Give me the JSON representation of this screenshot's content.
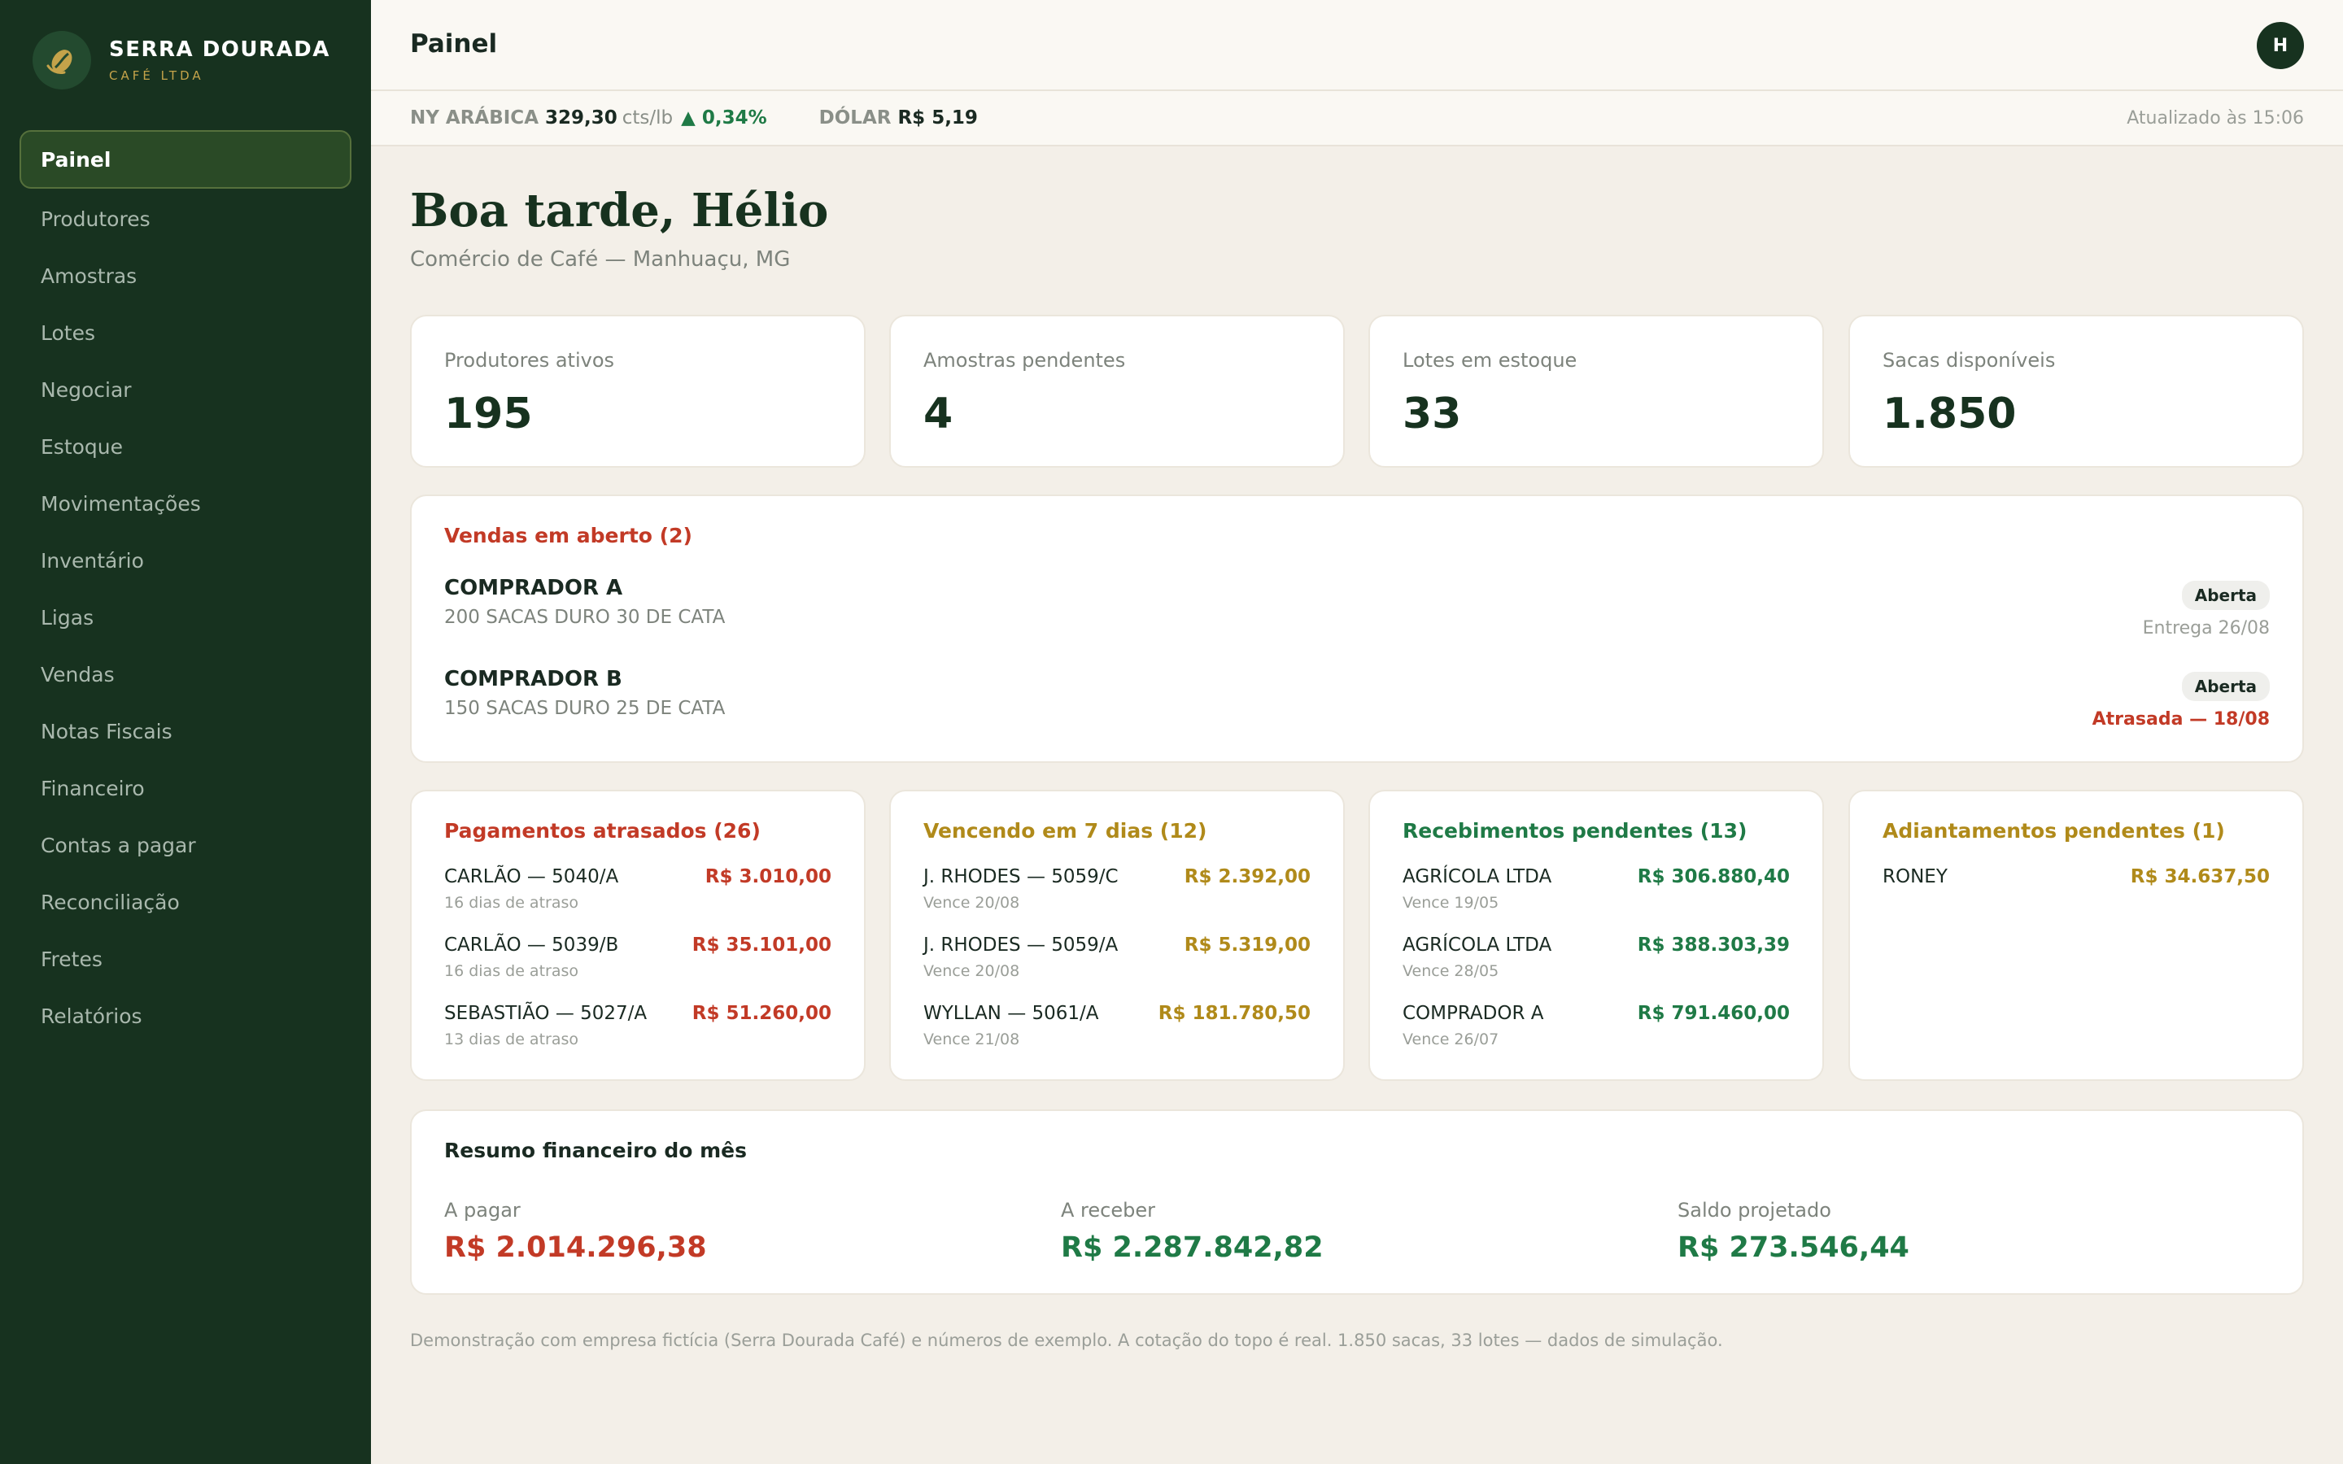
{
  "brand": {
    "name": "SERRA DOURADA",
    "sub": "CAFÉ LTDA"
  },
  "sidebar": {
    "items": [
      {
        "label": "Painel",
        "active": true
      },
      {
        "label": "Produtores"
      },
      {
        "label": "Amostras"
      },
      {
        "label": "Lotes"
      },
      {
        "label": "Negociar"
      },
      {
        "label": "Estoque"
      },
      {
        "label": "Movimentações"
      },
      {
        "label": "Inventário"
      },
      {
        "label": "Ligas"
      },
      {
        "label": "Vendas"
      },
      {
        "label": "Notas Fiscais"
      },
      {
        "label": "Financeiro"
      },
      {
        "label": "Contas a pagar"
      },
      {
        "label": "Reconciliação"
      },
      {
        "label": "Fretes"
      },
      {
        "label": "Relatórios"
      }
    ]
  },
  "header": {
    "title": "Painel",
    "avatar_initial": "H"
  },
  "ticker": {
    "arabica_label": "NY ARÁBICA",
    "arabica_value": "329,30",
    "arabica_unit": "cts/lb",
    "arabica_change": "▲ 0,34%",
    "dollar_label": "DÓLAR",
    "dollar_value": "R$ 5,19",
    "updated": "Atualizado às 15:06"
  },
  "greeting": {
    "title": "Boa tarde, Hélio",
    "subtitle": "Comércio de Café — Manhuaçu, MG"
  },
  "stats": [
    {
      "label": "Produtores ativos",
      "value": "195"
    },
    {
      "label": "Amostras pendentes",
      "value": "4"
    },
    {
      "label": "Lotes em estoque",
      "value": "33"
    },
    {
      "label": "Sacas disponíveis",
      "value": "1.850"
    }
  ],
  "open_sales": {
    "title": "Vendas em aberto (2)",
    "items": [
      {
        "buyer": "COMPRADOR A",
        "desc": "200 SACAS DURO 30 DE CATA",
        "status": "Aberta",
        "date": "Entrega 26/08",
        "late": false
      },
      {
        "buyer": "COMPRADOR B",
        "desc": "150 SACAS DURO 25 DE CATA",
        "status": "Aberta",
        "date": "Atrasada — 18/08",
        "late": true
      }
    ]
  },
  "panels": [
    {
      "title": "Pagamentos atrasados (26)",
      "color": "#c23a26",
      "rows": [
        {
          "name": "CARLÃO — 5040/A",
          "sub": "16 dias de atraso",
          "amount": "R$ 3.010,00"
        },
        {
          "name": "CARLÃO — 5039/B",
          "sub": "16 dias de atraso",
          "amount": "R$ 35.101,00"
        },
        {
          "name": "SEBASTIÃO — 5027/A",
          "sub": "13 dias de atraso",
          "amount": "R$ 51.260,00"
        }
      ]
    },
    {
      "title": "Vencendo em 7 dias (12)",
      "color": "#b08a1a",
      "rows": [
        {
          "name": "J. RHODES — 5059/C",
          "sub": "Vence 20/08",
          "amount": "R$ 2.392,00"
        },
        {
          "name": "J. RHODES — 5059/A",
          "sub": "Vence 20/08",
          "amount": "R$ 5.319,00"
        },
        {
          "name": "WYLLAN — 5061/A",
          "sub": "Vence 21/08",
          "amount": "R$ 181.780,50"
        }
      ]
    },
    {
      "title": "Recebimentos pendentes (13)",
      "color": "#1f7a46",
      "rows": [
        {
          "name": "AGRÍCOLA LTDA",
          "sub": "Vence 19/05",
          "amount": "R$ 306.880,40"
        },
        {
          "name": "AGRÍCOLA LTDA",
          "sub": "Vence 28/05",
          "amount": "R$ 388.303,39"
        },
        {
          "name": "COMPRADOR A",
          "sub": "Vence 26/07",
          "amount": "R$ 791.460,00"
        }
      ]
    },
    {
      "title": "Adiantamentos pendentes (1)",
      "color": "#b08a1a",
      "rows": [
        {
          "name": "RONEY",
          "sub": "",
          "amount": "R$ 34.637,50"
        }
      ]
    }
  ],
  "summary": {
    "title": "Resumo financeiro do mês",
    "items": [
      {
        "label": "A pagar",
        "value": "R$ 2.014.296,38",
        "color": "#c23a26"
      },
      {
        "label": "A receber",
        "value": "R$ 2.287.842,82",
        "color": "#1f7a46"
      },
      {
        "label": "Saldo projetado",
        "value": "R$ 273.546,44",
        "color": "#1f7a46"
      }
    ]
  },
  "footer": "Demonstração com empresa fictícia (Serra Dourada Café) e números de exemplo. A cotação do topo é real. 1.850 sacas, 33 lotes — dados de simulação."
}
